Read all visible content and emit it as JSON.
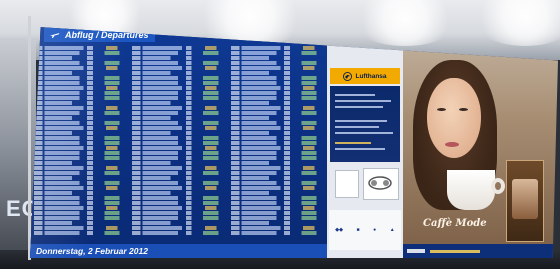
{
  "board": {
    "header_title": "Abflug / Departures",
    "footer_date": "Donnerstag, 2 Februar 2012"
  },
  "promo": {
    "airline": "Lufthansa"
  },
  "ad": {
    "brand": "Caffè Mode"
  },
  "colors": {
    "board_blue": "#0b2f82",
    "header_blue": "#1b56c2",
    "lufthansa_yellow": "#f2a900",
    "status_green": "#9fe08f"
  },
  "icons": {
    "plane": "plane-icon",
    "crane": "lufthansa-crane-icon"
  }
}
